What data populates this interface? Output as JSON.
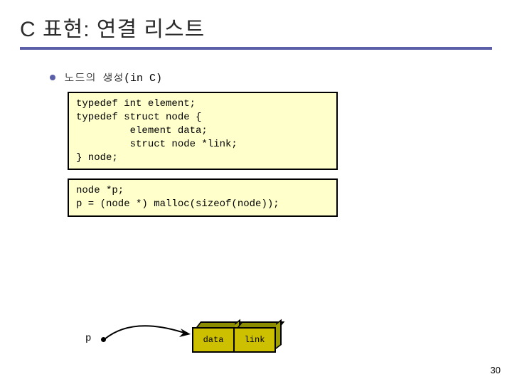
{
  "title": "C 표현: 연결 리스트",
  "subhead": "노드의 생성(in C)",
  "code_block_1": "typedef int element;\ntypedef struct node {\n         element data;\n         struct node *link;\n} node;",
  "code_block_2": "node *p;\np = (node *) malloc(sizeof(node));",
  "diagram": {
    "pointer_label": "p",
    "cells": [
      "data",
      "link"
    ]
  },
  "page_number": "30"
}
